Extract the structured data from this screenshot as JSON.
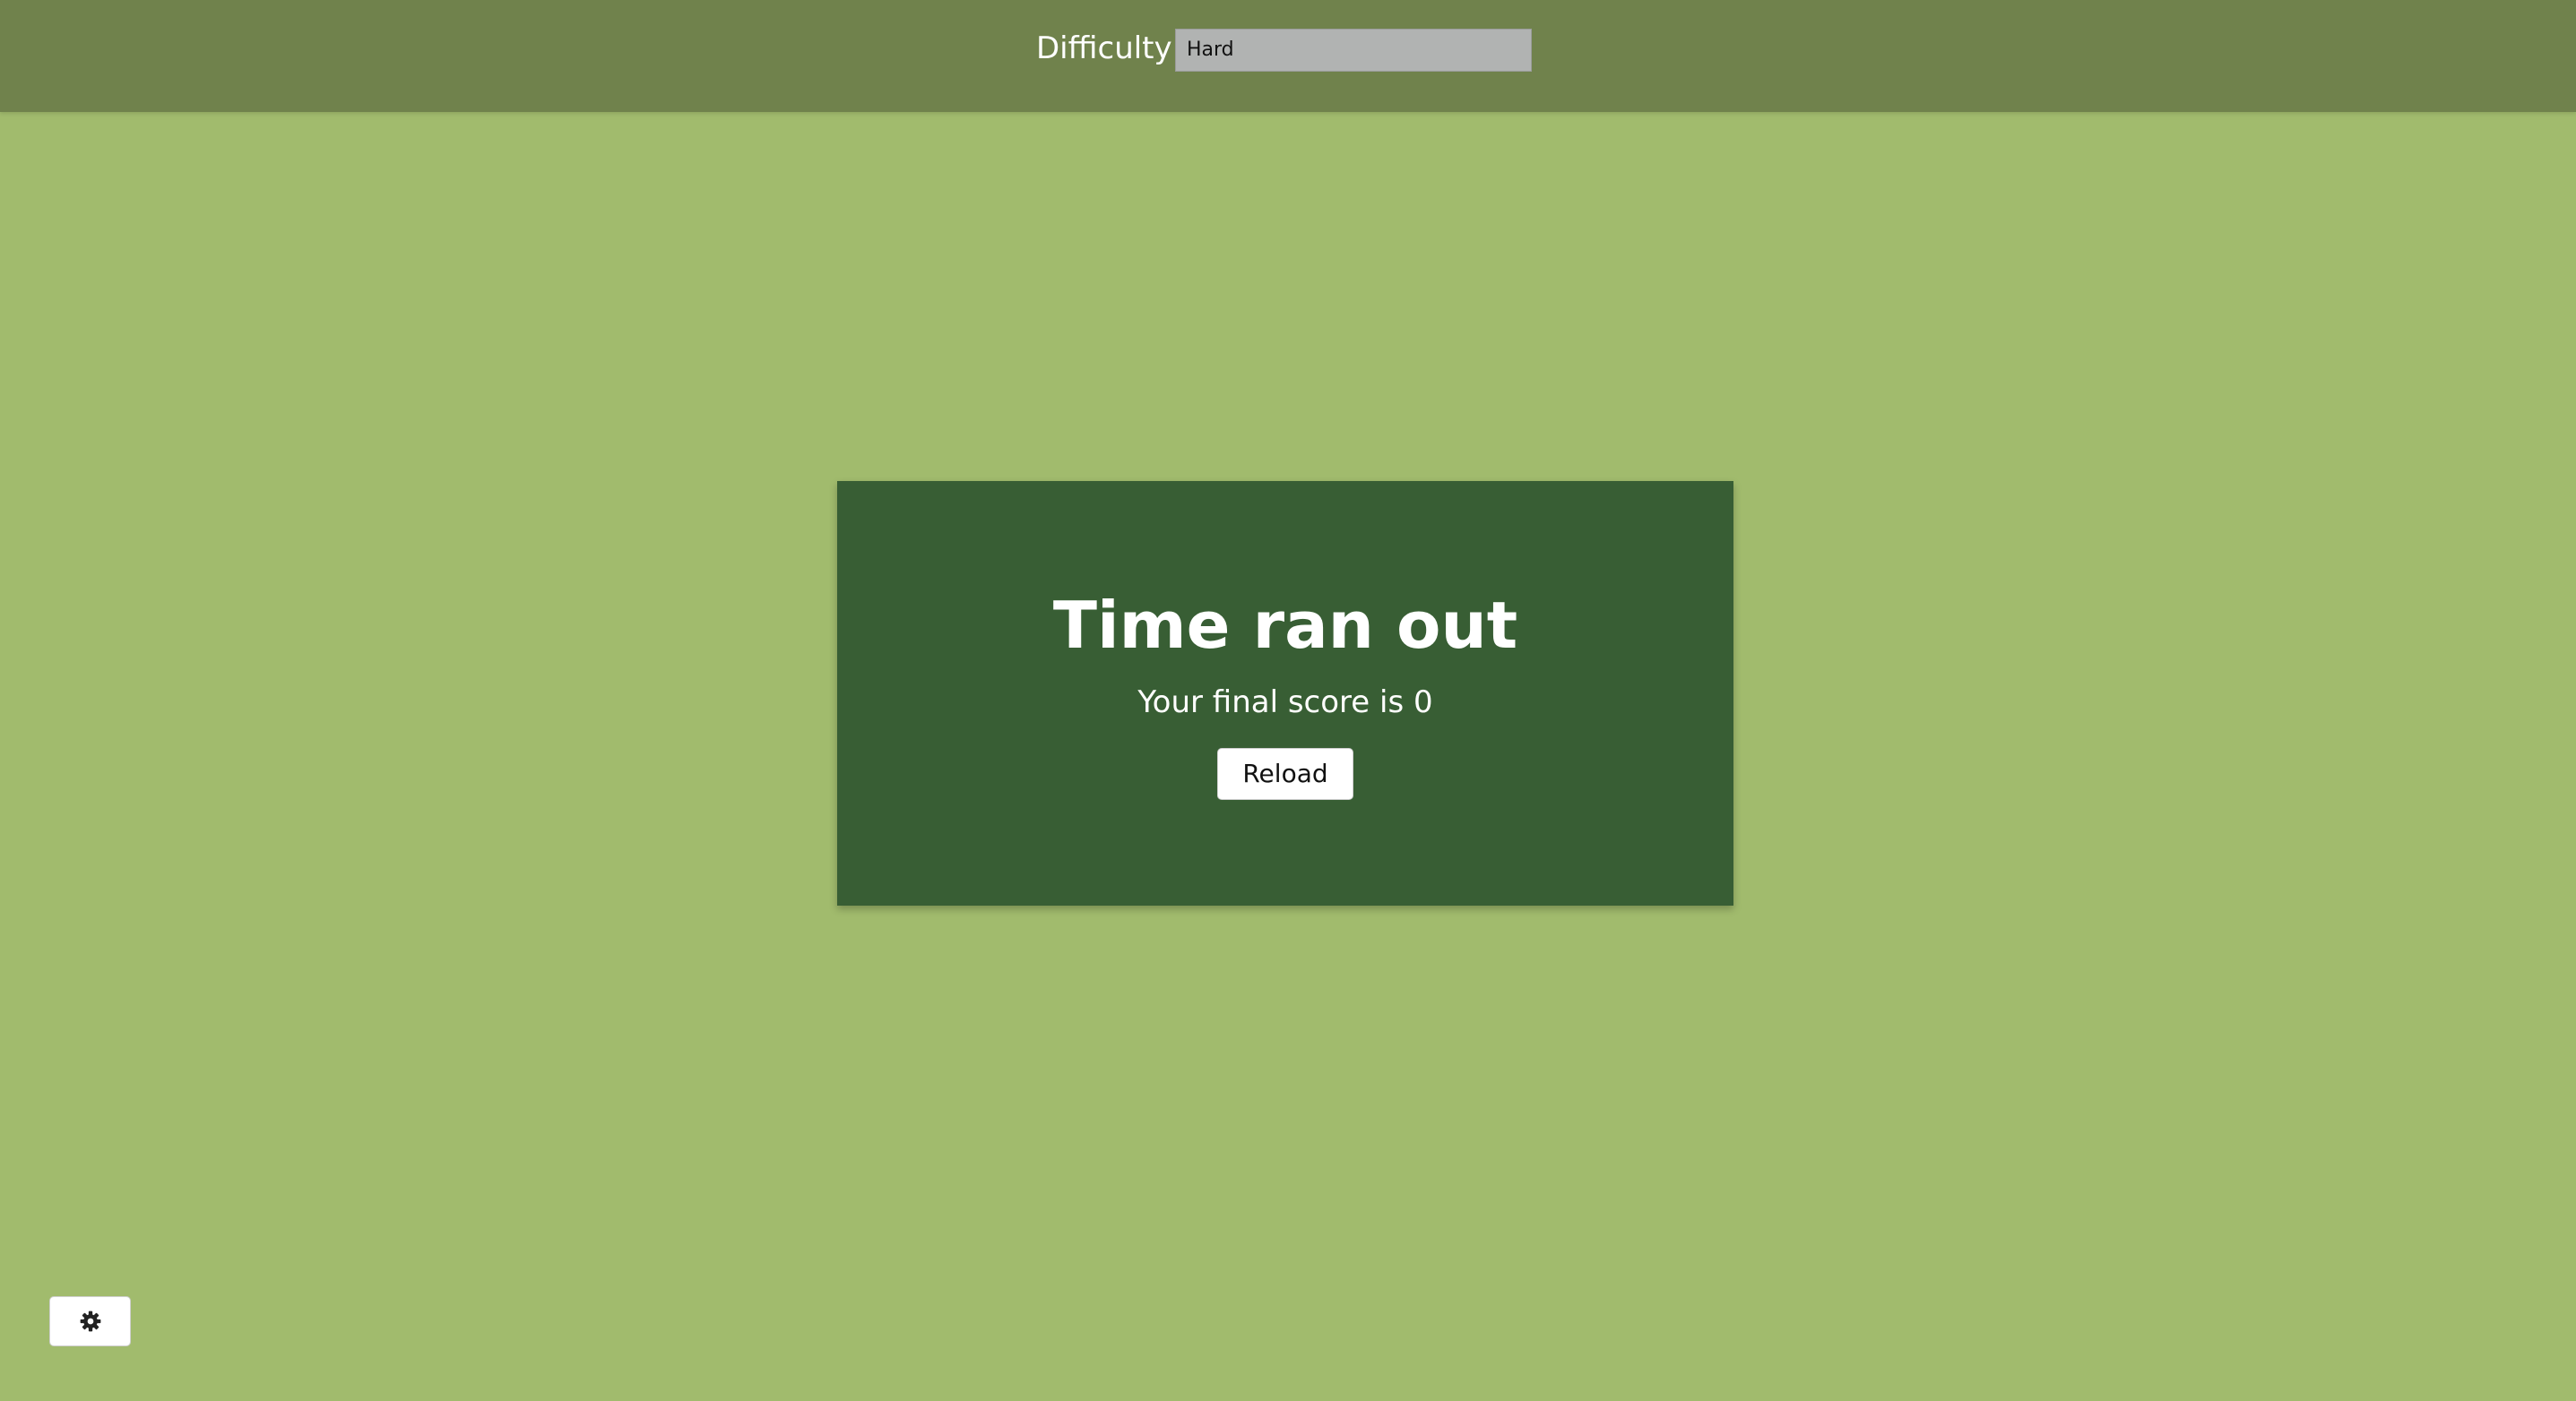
{
  "header": {
    "difficulty_label": "Difficulty",
    "difficulty_value": "Hard"
  },
  "modal": {
    "title": "Time ran out",
    "score_text": "Your final score is 0",
    "reload_label": "Reload"
  },
  "settings": {
    "icon": "gear-icon"
  },
  "colors": {
    "page_background": "#a1bb6d",
    "topbar_background": "#70824c",
    "modal_background": "#385e34",
    "select_background": "#b1b3b2"
  }
}
